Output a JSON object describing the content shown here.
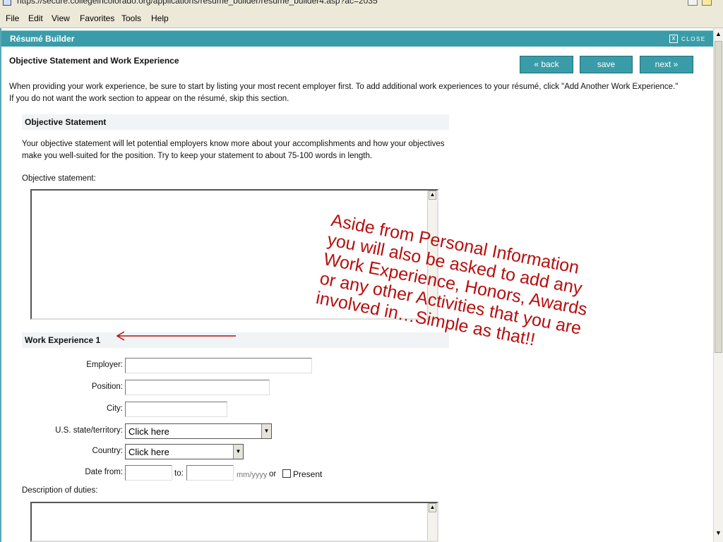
{
  "browser": {
    "url": "https://secure.collegeincolorado.org/applications/resume_builder/resume_builder4.asp?ac=2035",
    "menu": [
      "File",
      "Edit",
      "View",
      "Favorites",
      "Tools",
      "Help"
    ]
  },
  "app": {
    "title": "Résumé Builder",
    "close_label": "CLOSE",
    "close_glyph": "x"
  },
  "page": {
    "title": "Objective Statement and Work Experience",
    "back_label": "« back",
    "save_label": "save",
    "next_label": "next »",
    "intro": "When providing your work experience, be sure to start by listing your most recent employer first. To add additional work experiences to your résumé, click \"Add Another Work Experience.\" If you do not want the work section to appear on the résumé, skip this section."
  },
  "objective": {
    "heading": "Objective Statement",
    "description": "Your objective statement will let potential employers know more about your accomplishments and how your objectives make you well-suited for the position. Try to keep your statement to about 75-100 words in length.",
    "field_label": "Objective statement:"
  },
  "work": {
    "heading": "Work Experience 1",
    "employer_label": "Employer:",
    "position_label": "Position:",
    "city_label": "City:",
    "state_label": "U.S. state/territory:",
    "state_value": "Click here",
    "country_label": "Country:",
    "country_value": "Click here",
    "date_from_label": "Date from:",
    "to_label": "to:",
    "date_hint": "mm/yyyy",
    "or_label": "or",
    "present_label": "Present",
    "duties_label": "Description of duties:"
  },
  "annotation": {
    "text": "Aside from Personal Information\nyou will also be asked to add any\nWork Experience, Honors, Awards\nor any other Activities that you are\ninvolved in…Simple as that!!",
    "color": "#b80e0e"
  },
  "colors": {
    "accent": "#3a9ca8"
  }
}
